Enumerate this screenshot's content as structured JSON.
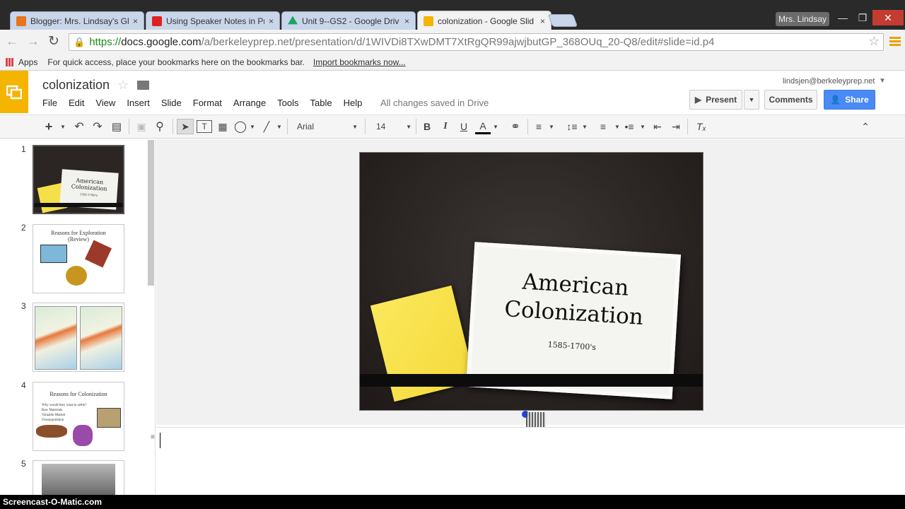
{
  "browser": {
    "tabs": [
      {
        "title": "Blogger: Mrs. Lindsay's Gl",
        "color": "#e8731d"
      },
      {
        "title": "Using Speaker Notes in Pr",
        "color": "#e02020"
      },
      {
        "title": "Unit 9--GS2 - Google Driv",
        "color": "#1ea362"
      },
      {
        "title": "colonization - Google Slid",
        "color": "#f4b400"
      }
    ],
    "tab_close": "×",
    "user_badge": "Mrs. Lindsay",
    "url_scheme": "https://",
    "url_domain": "docs.google.com",
    "url_path": "/a/berkeleyprep.net/presentation/d/1WIVDi8TXwDMT7XtRgQR99ajwjbutGP_368OUq_20-Q8/edit#slide=id.p4",
    "bookmarks_apps": "Apps",
    "bookmarks_hint": "For quick access, place your bookmarks here on the bookmarks bar.",
    "bookmarks_import": "Import bookmarks now..."
  },
  "doc": {
    "title": "colonization",
    "menu": [
      "File",
      "Edit",
      "View",
      "Insert",
      "Slide",
      "Format",
      "Arrange",
      "Tools",
      "Table",
      "Help"
    ],
    "saved": "All changes saved in Drive",
    "email": "lindsjen@berkeleyprep.net",
    "present": "Present",
    "comments": "Comments",
    "share": "Share"
  },
  "toolbar": {
    "font": "Arial",
    "size": "14",
    "bold": "B",
    "italic": "I",
    "underline": "U",
    "textcolor": "A"
  },
  "slides": {
    "numbers": [
      "1",
      "2",
      "3",
      "4",
      "5"
    ],
    "s1_title": "American Colonization",
    "s1_sub": "1585-1700's",
    "s2_title": "Reasons for Exploration (Review)",
    "s4_title": "Reasons for Colonization",
    "s4_bullets": [
      "Why would they want to settle?",
      "Raw Materials",
      "Valuable Market",
      "Overpopulation"
    ]
  },
  "main_slide": {
    "title_line1": "American",
    "title_line2": "Colonization",
    "subtitle": "1585-1700's"
  },
  "footer": "Screencast-O-Matic.com"
}
